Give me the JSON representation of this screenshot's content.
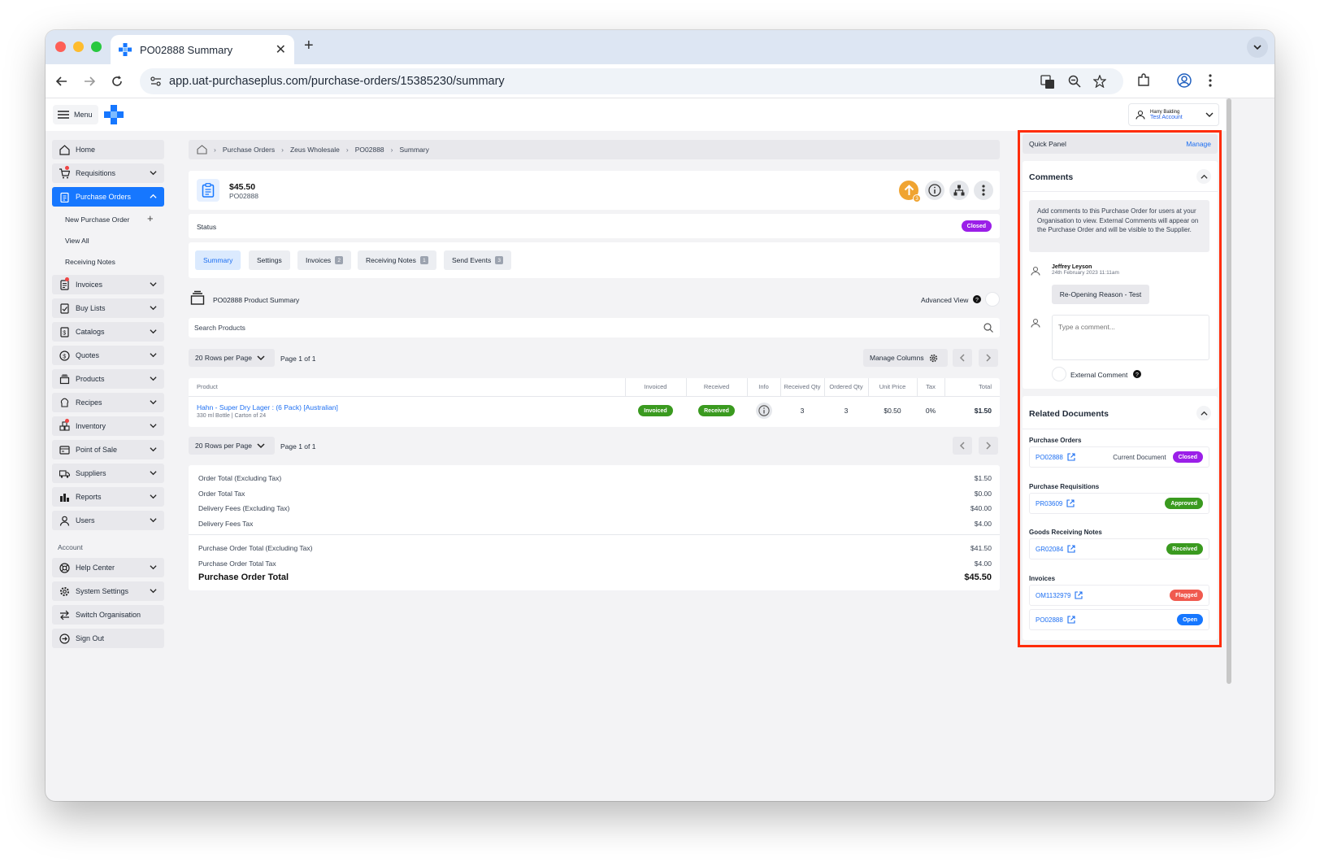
{
  "browser": {
    "tab_title": "PO02888 Summary",
    "url": "app.uat-purchaseplus.com/purchase-orders/15385230/summary"
  },
  "header": {
    "menu_label": "Menu",
    "user_name": "Harry Balding",
    "user_account": "Test Account"
  },
  "sidebar": {
    "items": [
      {
        "label": "Home",
        "icon": "home-icon"
      },
      {
        "label": "Requisitions",
        "icon": "cart-icon"
      },
      {
        "label": "Purchase Orders",
        "icon": "clipboard-icon"
      },
      {
        "label": "Invoices",
        "icon": "invoice-icon"
      },
      {
        "label": "Buy Lists",
        "icon": "checklist-icon"
      },
      {
        "label": "Catalogs",
        "icon": "catalog-icon"
      },
      {
        "label": "Quotes",
        "icon": "dollar-icon"
      },
      {
        "label": "Products",
        "icon": "box-icon"
      },
      {
        "label": "Recipes",
        "icon": "chef-hat-icon"
      },
      {
        "label": "Inventory",
        "icon": "inventory-icon"
      },
      {
        "label": "Point of Sale",
        "icon": "pos-icon"
      },
      {
        "label": "Suppliers",
        "icon": "truck-icon"
      },
      {
        "label": "Reports",
        "icon": "chart-icon"
      },
      {
        "label": "Users",
        "icon": "user-icon"
      }
    ],
    "sub_items": [
      "New Purchase Order",
      "View All",
      "Receiving Notes"
    ],
    "account_label": "Account",
    "account_items": [
      {
        "label": "Help Center",
        "icon": "lifebuoy-icon"
      },
      {
        "label": "System Settings",
        "icon": "gear-icon"
      },
      {
        "label": "Switch Organisation",
        "icon": "swap-icon"
      },
      {
        "label": "Sign Out",
        "icon": "sign-out-icon"
      }
    ]
  },
  "breadcrumb": [
    "Purchase Orders",
    "Zeus Wholesale",
    "PO02888",
    "Summary"
  ],
  "po": {
    "amount": "$45.50",
    "number": "PO02888",
    "notification_count": "3",
    "status_label": "Status",
    "status": "Closed",
    "status_color": "#9b1fe8"
  },
  "tabs": [
    {
      "label": "Summary",
      "count": ""
    },
    {
      "label": "Settings",
      "count": ""
    },
    {
      "label": "Invoices",
      "count": "2"
    },
    {
      "label": "Receiving Notes",
      "count": "1"
    },
    {
      "label": "Send Events",
      "count": "3"
    }
  ],
  "product_summary": {
    "title": "PO02888 Product Summary",
    "advanced_view": "Advanced View",
    "search_placeholder": "Search Products",
    "rows_per_page": "20 Rows per Page",
    "page_info": "Page 1 of 1",
    "manage_columns": "Manage Columns",
    "columns": [
      "Product",
      "Invoiced",
      "Received",
      "Info",
      "Received Qty",
      "Ordered Qty",
      "Unit Price",
      "Tax",
      "Total"
    ],
    "rows": [
      {
        "name": "Hahn - Super Dry Lager : (6 Pack) [Australian]",
        "sub": "330 ml Bottle | Carton of 24",
        "invoiced": "Invoiced",
        "received": "Received",
        "received_qty": "3",
        "ordered_qty": "3",
        "unit_price": "$0.50",
        "tax": "0%",
        "total": "$1.50"
      }
    ]
  },
  "totals": [
    {
      "label": "Order Total (Excluding Tax)",
      "value": "$1.50"
    },
    {
      "label": "Order Total Tax",
      "value": "$0.00"
    },
    {
      "label": "Delivery Fees (Excluding Tax)",
      "value": "$40.00"
    },
    {
      "label": "Delivery Fees Tax",
      "value": "$4.00"
    },
    {
      "label": "Purchase Order Total (Excluding Tax)",
      "value": "$41.50"
    },
    {
      "label": "Purchase Order Total Tax",
      "value": "$4.00"
    },
    {
      "label": "Purchase Order Total",
      "value": "$45.50"
    }
  ],
  "quick_panel": {
    "title": "Quick Panel",
    "manage": "Manage",
    "comments_title": "Comments",
    "comments_info": "Add comments to this Purchase Order for users at your Organisation to view. External Comments will appear on the Purchase Order and will be visible to the Supplier.",
    "comment": {
      "author": "Jeffrey Leyson",
      "date": "24th February 2023 11:11am",
      "text": "Re-Opening Reason - Test"
    },
    "comment_placeholder": "Type a comment...",
    "external_comment": "External Comment",
    "related_title": "Related Documents",
    "groups": [
      {
        "label": "Purchase Orders",
        "docs": [
          {
            "id": "PO02888",
            "note": "Current Document",
            "status": "Closed",
            "color": "#9b1fe8"
          }
        ]
      },
      {
        "label": "Purchase Requisitions",
        "docs": [
          {
            "id": "PR03609",
            "note": "",
            "status": "Approved",
            "color": "#3a9a1f"
          }
        ]
      },
      {
        "label": "Goods Receiving Notes",
        "docs": [
          {
            "id": "GR02084",
            "note": "",
            "status": "Received",
            "color": "#3a9a1f"
          }
        ]
      },
      {
        "label": "Invoices",
        "docs": [
          {
            "id": "OM1132979",
            "note": "",
            "status": "Flagged",
            "color": "#f05a4f"
          },
          {
            "id": "PO02888",
            "note": "",
            "status": "Open",
            "color": "#1677ff"
          }
        ]
      }
    ]
  },
  "colors": {
    "accent": "#1677ff",
    "success": "#3a9a1f",
    "warning": "#f0a431",
    "highlight_outline": "#ff2d0a"
  }
}
